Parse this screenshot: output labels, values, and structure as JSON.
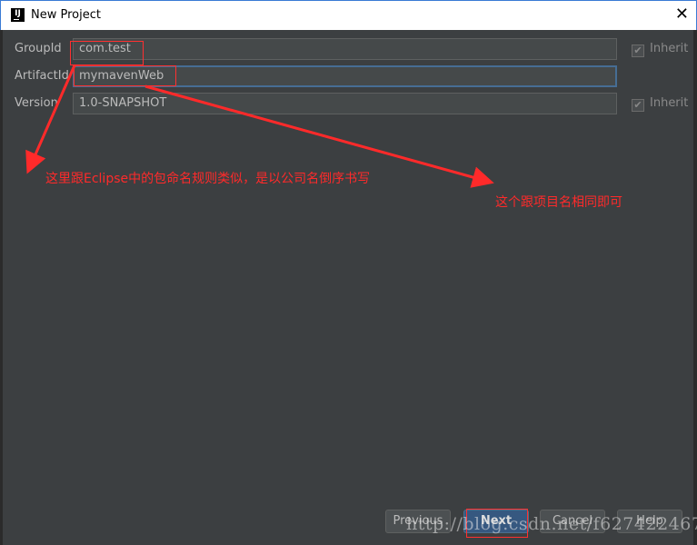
{
  "window": {
    "title": "New Project",
    "close_icon": "close-icon"
  },
  "form": {
    "group_label": "GroupId",
    "group_value": "com.test",
    "artifact_label": "ArtifactId",
    "artifact_value": "mymavenWeb",
    "version_label": "Version",
    "version_value": "1.0-SNAPSHOT",
    "inherit_label": "Inherit",
    "inherit_checked": true
  },
  "buttons": {
    "previous": "Previous",
    "next": "Next",
    "cancel": "Cancel",
    "help": "Help"
  },
  "annotations": {
    "group_note": "这里跟Eclipse中的包命名规则类似，是以公司名倒序书写",
    "artifact_note": "这个跟项目名相同即可",
    "color": "#ff2a2a"
  },
  "watermark": "http://blog.csdn.net/f627422467"
}
